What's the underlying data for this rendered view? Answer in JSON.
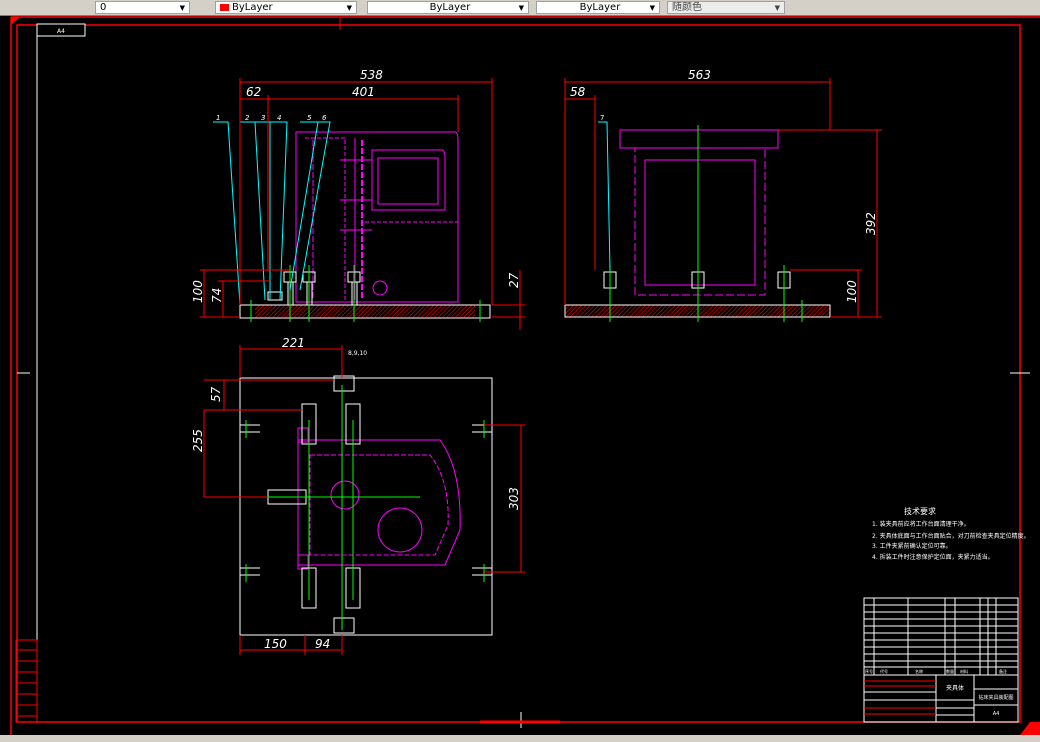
{
  "toolbar": {
    "layer_control": "0",
    "color_control": "ByLayer",
    "linetype_control": "ByLayer",
    "lineweight_control": "ByLayer",
    "plotstyle_control": "随颜色"
  },
  "drawing": {
    "sheet_label": "A4",
    "front_view": {
      "dims": [
        "538",
        "62",
        "401",
        "100",
        "74",
        "27"
      ],
      "balloons": [
        "1",
        "2",
        "3",
        "4",
        "5",
        "6"
      ]
    },
    "side_view": {
      "dims": [
        "563",
        "58",
        "392",
        "100"
      ],
      "balloons": [
        "7"
      ]
    },
    "top_view": {
      "dims": [
        "221",
        "57",
        "255",
        "303",
        "150",
        "94"
      ],
      "balloons": "8,9,10"
    },
    "tech_requirements": {
      "title": "技术要求",
      "items": [
        "1. 装夹具前应将工作台面清理干净。",
        "2. 夹具体底面与工作台面贴合，对刀前检查夹具定位精度。",
        "3. 工件夹紧前确认定位可靠。",
        "4. 拆装工件时注意保护定位面，夹紧力适当。"
      ]
    },
    "title_block": {
      "part_name": "夹具体",
      "drawing_name": "钻床夹具装配图",
      "sheet": "A4",
      "headers": [
        "序号",
        "代号",
        "名称",
        "数量",
        "材料",
        "备注"
      ]
    }
  }
}
